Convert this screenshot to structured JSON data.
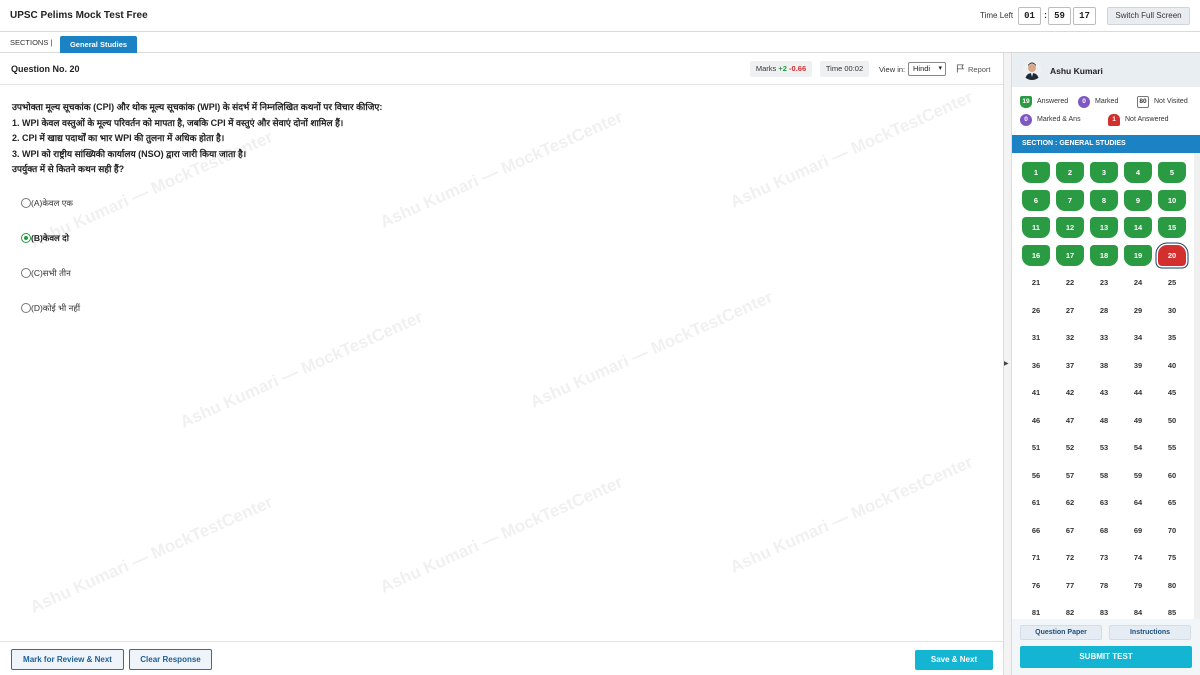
{
  "header": {
    "title": "UPSC Pelims Mock Test Free",
    "time_left_label": "Time Left",
    "timer": {
      "hours": "01",
      "minutes": "59",
      "seconds": "17"
    },
    "fullscreen_label": "Switch Full Screen"
  },
  "sections": {
    "label": "SECTIONS |",
    "tabs": [
      {
        "label": "General Studies"
      }
    ]
  },
  "question": {
    "number_label": "Question No. 20",
    "marks_label": "Marks",
    "marks_positive": "+2",
    "marks_negative": "-0.66",
    "time_label": "Time 00:02",
    "view_in_label": "View in:",
    "language": "Hindi",
    "report_label": "Report",
    "lines": [
      "उपभोक्ता मूल्य सूचकांक (CPI) और थोक मूल्य सूचकांक (WPI) के संदर्भ में निम्नलिखित कथनों पर विचार कीजिए:",
      "1. WPI केवल वस्तुओं के मूल्य परिवर्तन को मापता है, जबकि CPI में वस्तुएं और सेवाएं दोनों शामिल हैं।",
      "2. CPI में खाद्य पदार्थों का भार WPI की तुलना में अधिक होता है।",
      "3. WPI को राष्ट्रीय सांख्यिकी कार्यालय (NSO) द्वारा जारी किया जाता है।",
      "उपर्युक्त में से कितने कथन सही हैं?"
    ],
    "options": [
      {
        "label": "(A)केवल एक",
        "selected": false
      },
      {
        "label": "(B)केवल दो",
        "selected": true
      },
      {
        "label": "(C)सभी तीन",
        "selected": false
      },
      {
        "label": "(D)कोई भी नहीं",
        "selected": false
      }
    ]
  },
  "watermark": "Ashu Kumari — MockTestCenter",
  "footer": {
    "mark_review_label": "Mark for Review & Next",
    "clear_label": "Clear Response",
    "save_next_label": "Save & Next"
  },
  "panel": {
    "user_name": "Ashu Kumari",
    "legend": {
      "answered": {
        "count": "19",
        "label": "Answered"
      },
      "marked": {
        "count": "0",
        "label": "Marked"
      },
      "not_visited": {
        "count": "80",
        "label": "Not Visited"
      },
      "marked_ans": {
        "count": "0",
        "label": "Marked & Ans"
      },
      "not_answered": {
        "count": "1",
        "label": "Not Answered"
      }
    },
    "section_heading": "SECTION : GENERAL STUDIES",
    "question_palette": {
      "answered": [
        1,
        2,
        3,
        4,
        5,
        6,
        7,
        8,
        9,
        10,
        11,
        12,
        13,
        14,
        15,
        16,
        17,
        18,
        19
      ],
      "not_answered": [
        20
      ],
      "visible_numbers": [
        1,
        2,
        3,
        4,
        5,
        6,
        7,
        8,
        9,
        10,
        11,
        12,
        13,
        14,
        15,
        16,
        17,
        18,
        19,
        20,
        21,
        22,
        23,
        24,
        25,
        26,
        27,
        28,
        29,
        30,
        31,
        32,
        33,
        34,
        35,
        36,
        37,
        38,
        39,
        40,
        41,
        42,
        43,
        44,
        45,
        46,
        47,
        48,
        49,
        50,
        51,
        52,
        53,
        54,
        55,
        56,
        57,
        58,
        59,
        60,
        61,
        62,
        63,
        64,
        65,
        66,
        67,
        68,
        69,
        70,
        71,
        72,
        73,
        74,
        75,
        76,
        77,
        78,
        79,
        80,
        81,
        82,
        83,
        84,
        85
      ]
    },
    "question_paper_label": "Question Paper",
    "instructions_label": "Instructions",
    "submit_label": "SUBMIT TEST"
  },
  "colors": {
    "accent": "#1b83c3",
    "answered": "#2a9a43",
    "not_answered": "#d32f2f",
    "marked": "#7e57c2",
    "submit": "#13b5d3"
  }
}
